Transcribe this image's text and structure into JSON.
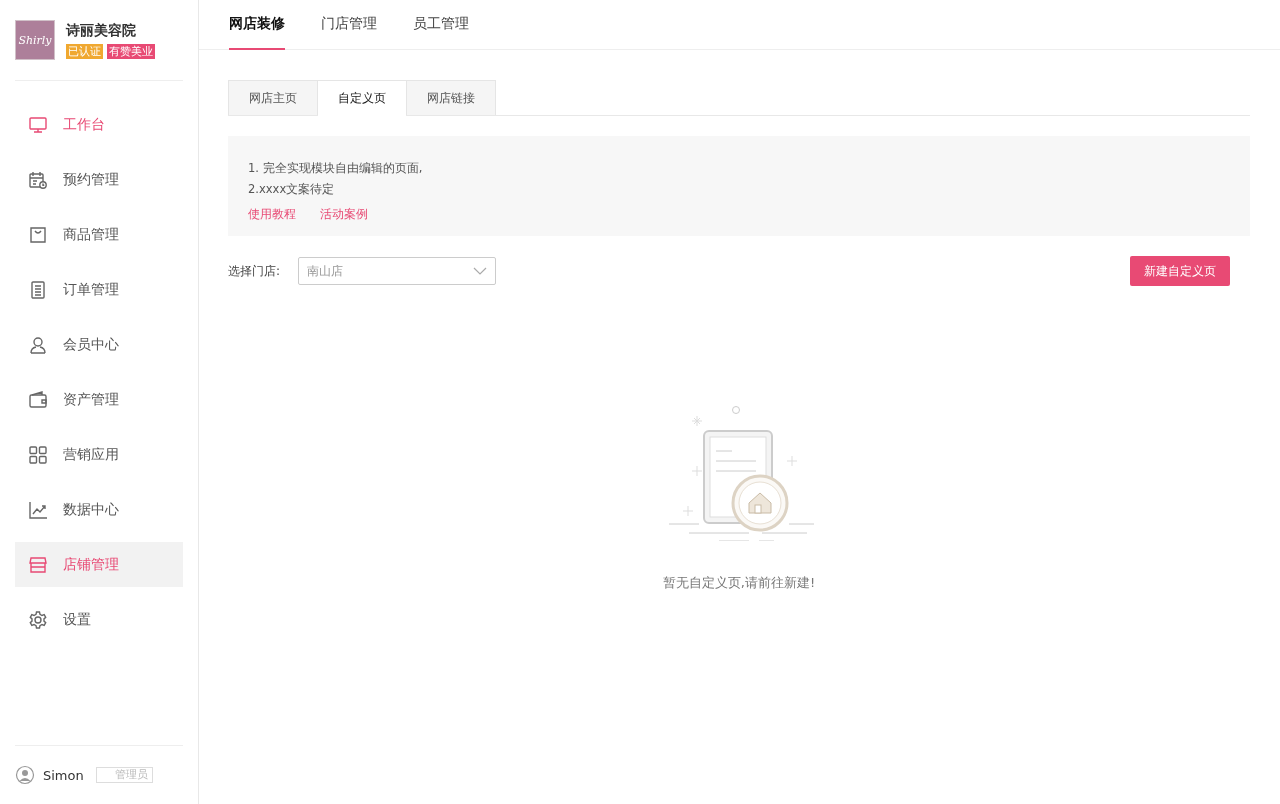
{
  "brand": {
    "logo_text": "Shirly",
    "name": "诗丽美容院",
    "badges": [
      {
        "text": "已认证",
        "color": "#f0a830"
      },
      {
        "text": "有赞美业",
        "color": "#e84a74"
      }
    ]
  },
  "sidebar": {
    "items": [
      {
        "label": "工作台",
        "highlighted": true,
        "selected": false
      },
      {
        "label": "预约管理",
        "highlighted": false,
        "selected": false
      },
      {
        "label": "商品管理",
        "highlighted": false,
        "selected": false
      },
      {
        "label": "订单管理",
        "highlighted": false,
        "selected": false
      },
      {
        "label": "会员中心",
        "highlighted": false,
        "selected": false
      },
      {
        "label": "资产管理",
        "highlighted": false,
        "selected": false
      },
      {
        "label": "营销应用",
        "highlighted": false,
        "selected": false
      },
      {
        "label": "数据中心",
        "highlighted": false,
        "selected": false
      },
      {
        "label": "店铺管理",
        "highlighted": true,
        "selected": true
      },
      {
        "label": "设置",
        "highlighted": false,
        "selected": false
      }
    ]
  },
  "user": {
    "name": "Simon",
    "role": "管理员"
  },
  "top_tabs": [
    {
      "label": "网店装修",
      "selected": true
    },
    {
      "label": "门店管理",
      "selected": false
    },
    {
      "label": "员工管理",
      "selected": false
    }
  ],
  "sub_tabs": [
    {
      "label": "网店主页",
      "selected": false
    },
    {
      "label": "自定义页",
      "selected": true
    },
    {
      "label": "网店链接",
      "selected": false
    }
  ],
  "notice": {
    "lines": [
      "1. 完全实现模块自由编辑的页面,",
      "2.xxxx文案待定"
    ],
    "links": [
      "使用教程",
      "活动案例"
    ]
  },
  "store_select": {
    "label": "选择门店:",
    "value": "南山店"
  },
  "create_button": "新建自定义页",
  "empty_message": "暂无自定义页,请前往新建!"
}
